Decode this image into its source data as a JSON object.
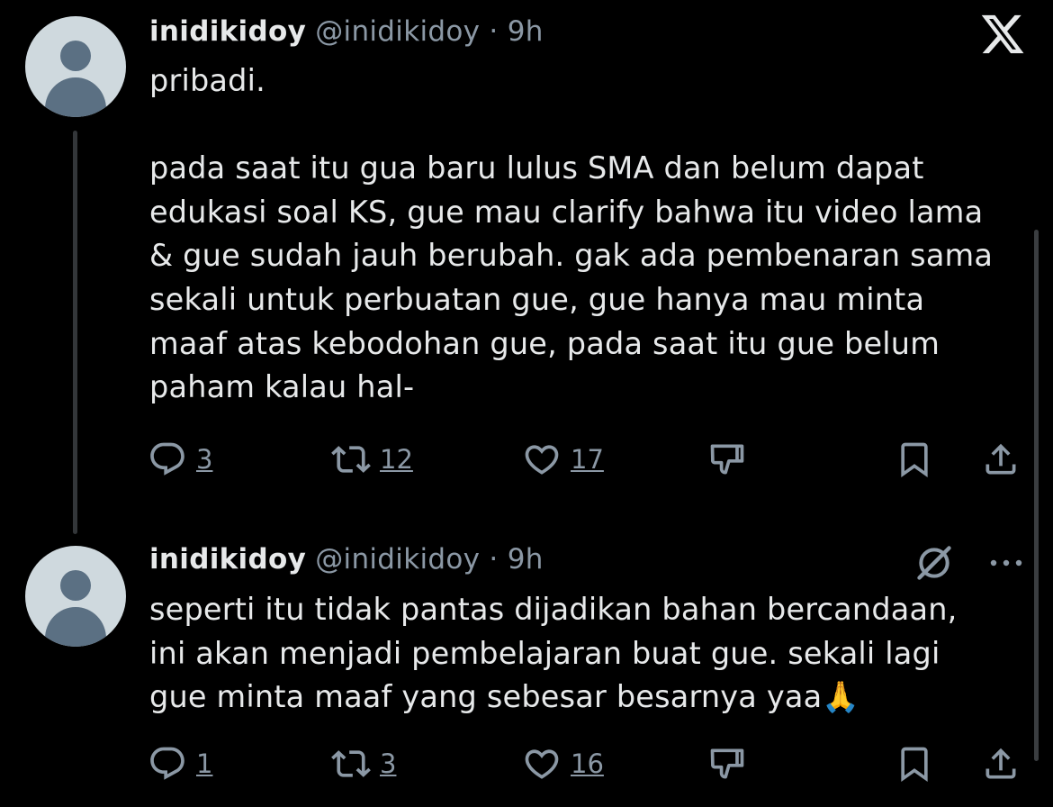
{
  "tweets": [
    {
      "name": "inidikidoy",
      "handle": "@inidikidoy",
      "time": "· 9h",
      "text": "pribadi.\n\npada saat itu gua baru lulus SMA dan belum dapat\nedukasi soal KS, gue mau clarify bahwa itu video lama\n& gue sudah jauh berubah. gak ada pembenaran sama\nsekali untuk perbuatan gue, gue hanya mau minta\nmaaf atas kebodohan gue, pada saat itu gue belum\npaham kalau hal-",
      "replies": "3",
      "retweets": "12",
      "likes": "17"
    },
    {
      "name": "inidikidoy",
      "handle": "@inidikidoy",
      "time": "· 9h",
      "text": "seperti itu tidak pantas dijadikan bahan bercandaan,\nini akan menjadi pembelajaran buat gue. sekali lagi\ngue minta maaf yang sebesar besarnya yaa🙏",
      "replies": "1",
      "retweets": "3",
      "likes": "16"
    }
  ],
  "icons": {
    "logo": "x-logo-icon",
    "reply": "reply-icon",
    "retweet": "retweet-icon",
    "like": "heart-icon",
    "dislike": "dislike-icon",
    "bookmark": "bookmark-icon",
    "share": "share-icon",
    "grok": "grok-icon",
    "more": "more-icon"
  },
  "colors": {
    "background": "#000000",
    "text": "#e7e9ea",
    "secondary": "#8b98a5",
    "avatar_bg": "#cfd9de",
    "avatar_fg": "#5b7083"
  }
}
